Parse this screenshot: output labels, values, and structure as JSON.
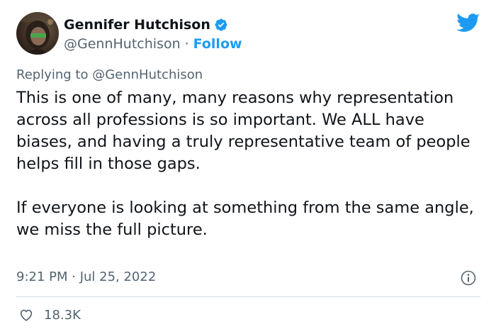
{
  "user": {
    "display_name": "Gennifer Hutchison",
    "handle": "@GennHutchison",
    "follow_label": "Follow",
    "separator": "·"
  },
  "reply": {
    "prefix": "Replying to ",
    "mention": "@GennHutchison"
  },
  "tweet": {
    "paragraphs": [
      "This is one of many, many reasons why representation across all professions is so important. We ALL have biases, and having a truly representative team of people helps fill in those gaps.",
      "If everyone is looking at something from the same angle, we miss the full picture."
    ],
    "timestamp": "9:21 PM · Jul 25, 2022"
  },
  "stats": {
    "likes": "18.3K"
  },
  "icons": {
    "verified": "verified-badge-icon",
    "platform": "twitter-bird-icon",
    "info": "info-icon",
    "like": "heart-icon"
  },
  "colors": {
    "accent": "#1d9bf0",
    "secondary_text": "#536471",
    "primary_text": "#0f1419",
    "divider": "#cfd9de"
  }
}
